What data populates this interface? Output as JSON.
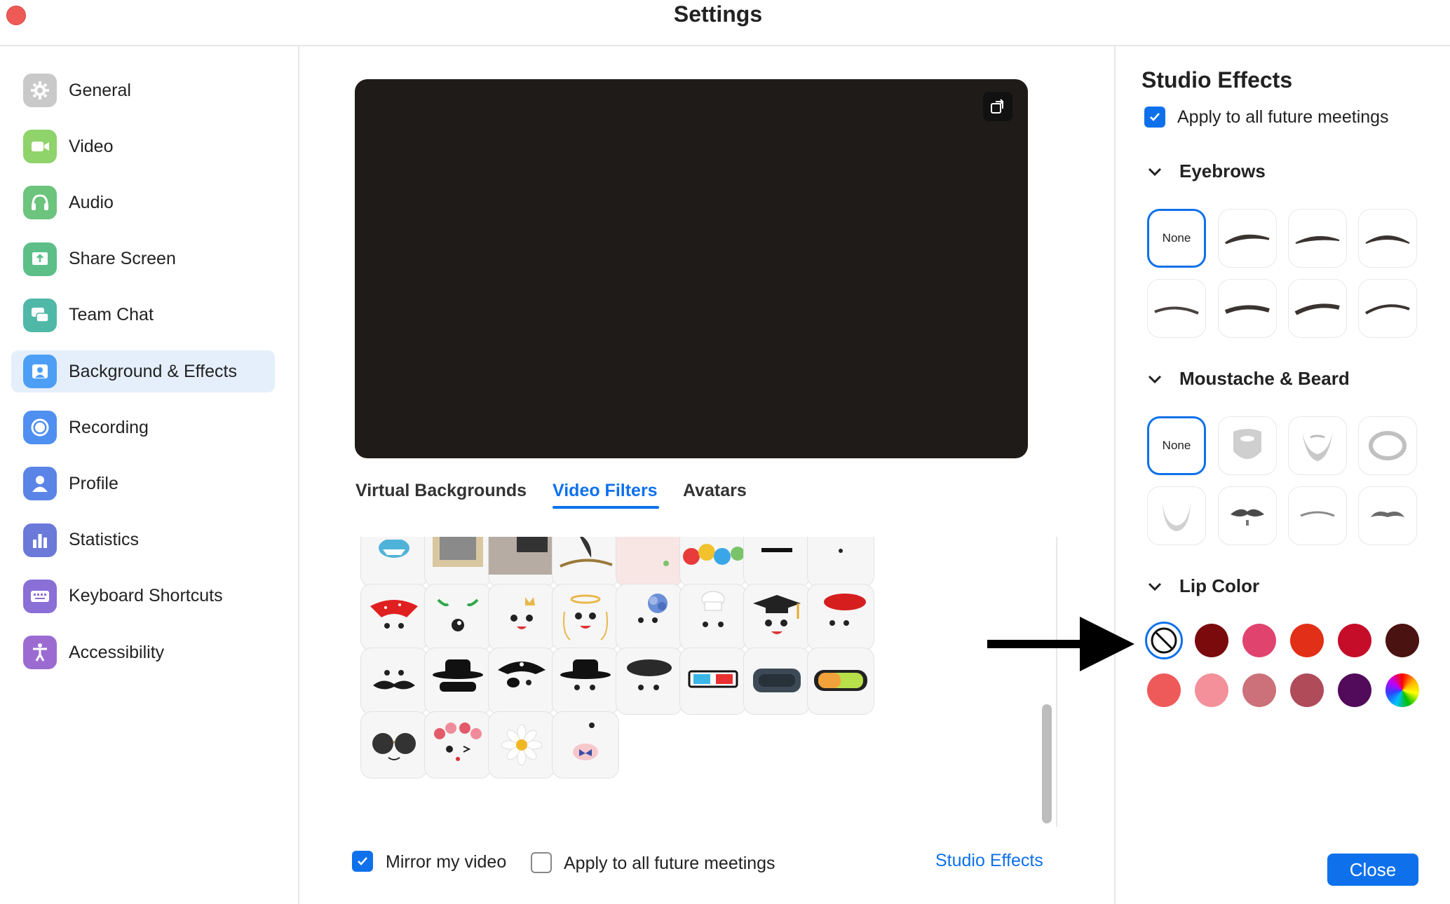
{
  "window": {
    "title": "Settings"
  },
  "sidebar": {
    "items": [
      {
        "label": "General",
        "icon": "gear-icon",
        "color": "#c9c9c9"
      },
      {
        "label": "Video",
        "icon": "video-camera-icon",
        "color": "#8fd36b"
      },
      {
        "label": "Audio",
        "icon": "headphones-icon",
        "color": "#6cc47d"
      },
      {
        "label": "Share Screen",
        "icon": "share-screen-icon",
        "color": "#5cbf88"
      },
      {
        "label": "Team Chat",
        "icon": "chat-bubbles-icon",
        "color": "#4fb8a7"
      },
      {
        "label": "Background & Effects",
        "icon": "person-background-icon",
        "color": "#4d9ff5"
      },
      {
        "label": "Recording",
        "icon": "record-icon",
        "color": "#4f8ff0"
      },
      {
        "label": "Profile",
        "icon": "profile-icon",
        "color": "#5a84e6"
      },
      {
        "label": "Statistics",
        "icon": "bar-chart-icon",
        "color": "#6b79d8"
      },
      {
        "label": "Keyboard Shortcuts",
        "icon": "keyboard-icon",
        "color": "#8a6fd6"
      },
      {
        "label": "Accessibility",
        "icon": "accessibility-icon",
        "color": "#9b6bd2"
      }
    ],
    "selected": "Background & Effects"
  },
  "main": {
    "tabs": [
      "Virtual Backgrounds",
      "Video Filters",
      "Avatars"
    ],
    "active_tab": "Video Filters",
    "filters": [
      "shark-mask-filter",
      "picture-frame-filter",
      "tv-room-filter",
      "bird-branch-filter",
      "pink-frame-filter",
      "lollipops-filter",
      "glasses-top-filter",
      "face-dots-filter",
      "red-bandana-filter",
      "antennae-filter",
      "crown-filter",
      "angel-halo-filter",
      "hydrangea-filter",
      "chef-hat-filter",
      "graduation-cap-filter",
      "red-beret-filter",
      "moustache-filter",
      "bandit-hat-filter",
      "pirate-filter",
      "black-hat-filter",
      "black-beret-filter",
      "3d-glasses-filter",
      "vr-headset-filter",
      "ski-goggles-filter",
      "round-sunglasses-filter",
      "flower-crown-filter",
      "daisy-filter",
      "butterfly-filter"
    ],
    "mirror_label": "Mirror my video",
    "mirror_checked": true,
    "apply_label": "Apply to all future meetings",
    "apply_checked": false,
    "studio_link": "Studio Effects"
  },
  "studio": {
    "title": "Studio Effects",
    "apply_label": "Apply to all future meetings",
    "apply_checked": true,
    "eyebrows": {
      "title": "Eyebrows",
      "none_label": "None",
      "selected": "None"
    },
    "beard": {
      "title": "Moustache & Beard",
      "none_label": "None",
      "selected": "None"
    },
    "lip": {
      "title": "Lip Color",
      "colors": [
        "none",
        "#7a0a0c",
        "#e0436e",
        "#e22f17",
        "#c50d2a",
        "#4a1210",
        "#ee5a5a",
        "#f3909a",
        "#cc7179",
        "#b04b5a",
        "#520a5a",
        "rainbow"
      ]
    },
    "close_label": "Close"
  },
  "annotation": {
    "type": "arrow",
    "target": "lip-color-none-swatch"
  }
}
